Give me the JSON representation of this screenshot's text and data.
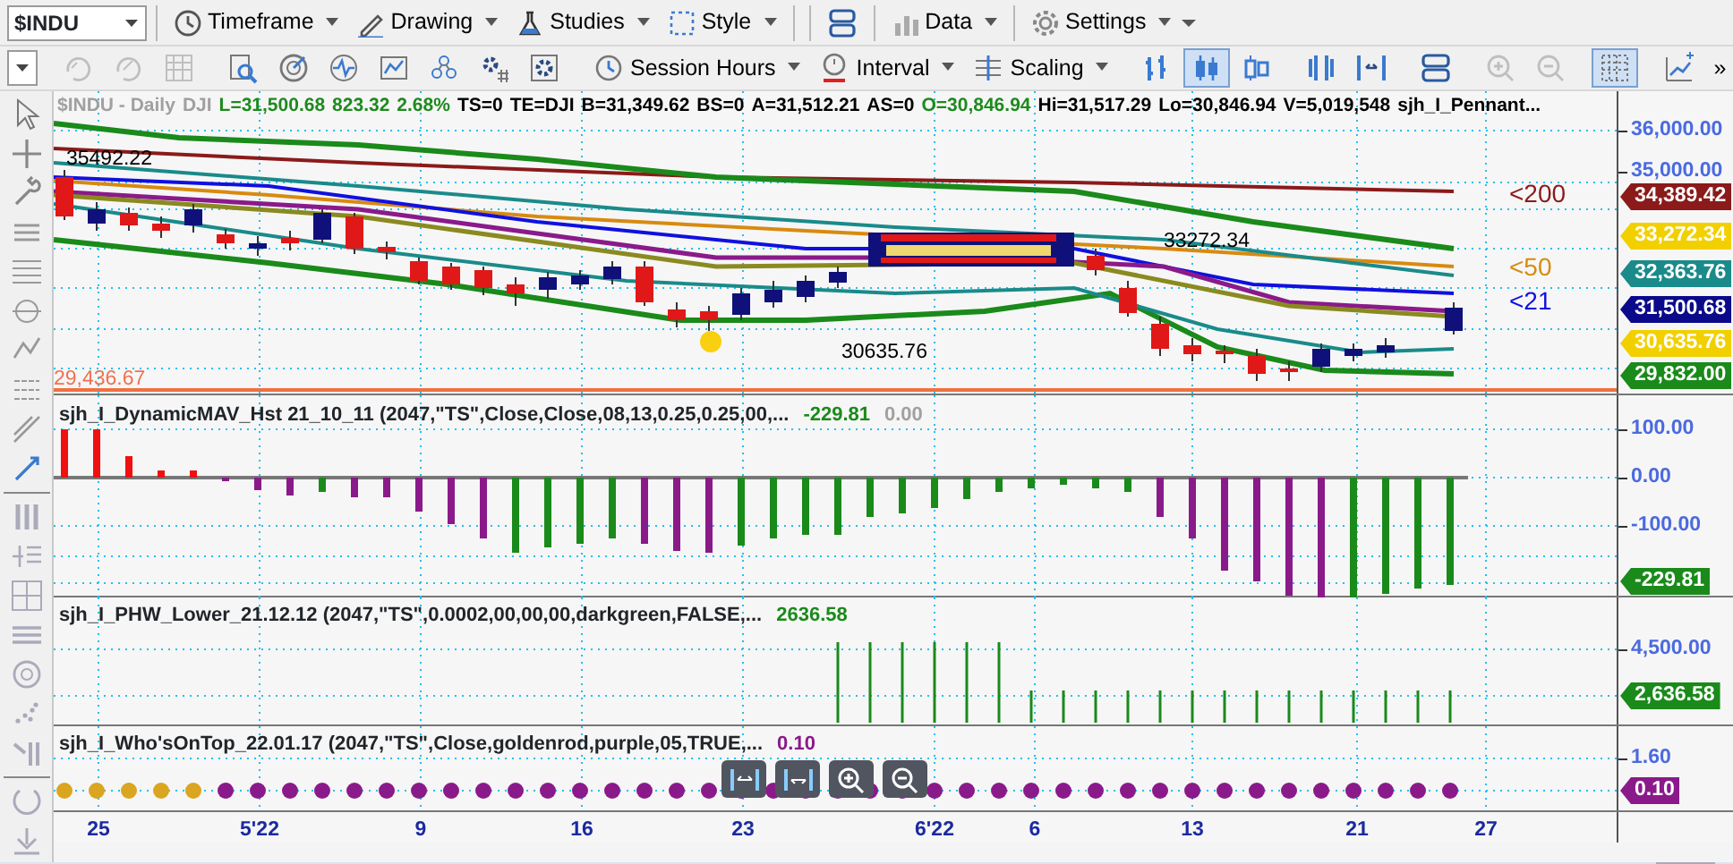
{
  "symbol_field": {
    "value": "$INDU"
  },
  "menu_toolbar": [
    {
      "kind": "menu",
      "label": "Timeframe"
    },
    {
      "kind": "menu",
      "label": "Drawing"
    },
    {
      "kind": "menu",
      "label": "Studies"
    },
    {
      "kind": "menu",
      "label": "Style"
    },
    {
      "kind": "icon"
    },
    {
      "kind": "menu",
      "label": "Data"
    },
    {
      "kind": "menu",
      "label": "Settings"
    }
  ],
  "chart_toolbar": {
    "items": [
      {
        "kind": "icon",
        "disabled": true,
        "selected": false
      },
      {
        "kind": "icon",
        "disabled": true,
        "selected": false
      },
      {
        "kind": "icon",
        "disabled": true,
        "selected": false
      },
      {
        "kind": "icon",
        "disabled": false,
        "selected": false
      },
      {
        "kind": "icon",
        "disabled": false,
        "selected": false
      },
      {
        "kind": "icon",
        "disabled": false,
        "selected": false
      },
      {
        "kind": "icon",
        "disabled": false,
        "selected": false
      },
      {
        "kind": "icon",
        "disabled": false,
        "selected": false
      },
      {
        "kind": "icon",
        "disabled": false,
        "selected": false
      },
      {
        "kind": "icon",
        "disabled": false,
        "selected": false
      },
      {
        "kind": "labeled",
        "label": "Session Hours",
        "disabled": false,
        "selected": false
      },
      {
        "kind": "labeled",
        "label": "Interval",
        "disabled": false,
        "selected": false
      },
      {
        "kind": "labeled",
        "label": "Scaling",
        "disabled": false,
        "selected": false
      },
      {
        "kind": "icon",
        "disabled": false,
        "selected": false
      },
      {
        "kind": "icon",
        "disabled": false,
        "selected": true
      },
      {
        "kind": "icon",
        "disabled": false,
        "selected": false
      },
      {
        "kind": "icon",
        "disabled": false,
        "selected": false
      },
      {
        "kind": "icon",
        "disabled": false,
        "selected": false
      },
      {
        "kind": "icon",
        "disabled": false,
        "selected": false
      },
      {
        "kind": "icon",
        "disabled": true,
        "selected": false
      },
      {
        "kind": "icon",
        "disabled": true,
        "selected": false
      },
      {
        "kind": "icon",
        "disabled": false,
        "selected": true
      },
      {
        "kind": "icon",
        "disabled": false,
        "selected": false
      }
    ],
    "overflow": "»"
  },
  "chart_header": [
    {
      "text": "$INDU - Daily",
      "color": "#a0a0a0"
    },
    {
      "text": "DJI",
      "color": "#a0a0a0"
    },
    {
      "text": "L=31,500.68",
      "color": "#1e8a1e"
    },
    {
      "text": "823.32",
      "color": "#1e8a1e"
    },
    {
      "text": "2.68%",
      "color": "#1e8a1e"
    },
    {
      "text": "TS=0",
      "color": "#000000"
    },
    {
      "text": "TE=DJI",
      "color": "#000000"
    },
    {
      "text": "B=31,349.62",
      "color": "#000000"
    },
    {
      "text": "BS=0",
      "color": "#000000"
    },
    {
      "text": "A=31,512.21",
      "color": "#000000"
    },
    {
      "text": "AS=0",
      "color": "#000000"
    },
    {
      "text": "O=30,846.94",
      "color": "#1e8a1e"
    },
    {
      "text": "Hi=31,517.29",
      "color": "#000000"
    },
    {
      "text": "Lo=30,846.94",
      "color": "#000000"
    },
    {
      "text": "V=5,019,548",
      "color": "#000000"
    },
    {
      "text": "sjh_I_Pennant...",
      "color": "#000000"
    }
  ],
  "price_pane": {
    "annotations": [
      {
        "text": "35492.22",
        "color": "#000000"
      },
      {
        "text": "33272.34",
        "color": "#000000"
      },
      {
        "text": "30635.76",
        "color": "#000000"
      },
      {
        "text": "<200",
        "color": "#8b1a1a"
      },
      {
        "text": "<50",
        "color": "#d88a10"
      },
      {
        "text": "<21",
        "color": "#1010e0"
      },
      {
        "text": "29,436.67",
        "color": "#f07050"
      }
    ],
    "axis_ticks": [
      "36,000.00",
      "35,000.00"
    ],
    "price_tags": [
      {
        "text": "34,389.42",
        "color": "#8b1a1a"
      },
      {
        "text": "33,272.34",
        "color": "#f2d000"
      },
      {
        "text": "32,363.76",
        "color": "#1a8a8a"
      },
      {
        "text": "31,500.68",
        "color": "#0a0a8a"
      },
      {
        "text": "30,635.76",
        "color": "#f2d000"
      },
      {
        "text": "29,832.00",
        "color": "#1a8a1a"
      }
    ]
  },
  "indicator_panes": [
    {
      "title": "sjh_I_DynamicMAV_Hst 21_10_11 (2047,\"TS\",Close,Close,08,13,0.25,0.25,00,...",
      "values": [
        {
          "text": "-229.81",
          "color": "#1a8a1a"
        },
        {
          "text": "0.00",
          "color": "#a0a0a0"
        }
      ],
      "axis_ticks": [
        "100.00",
        "0.00",
        "-100.00"
      ],
      "price_tags": [
        {
          "text": "-229.81",
          "color": "#1a8a1a"
        }
      ]
    },
    {
      "title": "sjh_I_PHW_Lower_21.12.12 (2047,\"TS\",0.0002,00,00,00,darkgreen,FALSE,...",
      "values": [
        {
          "text": "2636.58",
          "color": "#1a8a1a"
        }
      ],
      "axis_ticks": [
        "4,500.00"
      ],
      "price_tags": [
        {
          "text": "2,636.58",
          "color": "#1a8a1a"
        }
      ]
    },
    {
      "title": "sjh_I_Who'sOnTop_22.01.17 (2047,\"TS\",Close,goldenrod,purple,05,TRUE,...",
      "values": [
        {
          "text": "0.10",
          "color": "#8a1a8a"
        }
      ],
      "axis_ticks": [
        "1.60"
      ],
      "price_tags": [
        {
          "text": "0.10",
          "color": "#8a1a8a"
        }
      ]
    }
  ],
  "date_axis": [
    "25",
    "5'22",
    "9",
    "16",
    "23",
    "6'22",
    "6",
    "13",
    "21",
    "27"
  ]
}
